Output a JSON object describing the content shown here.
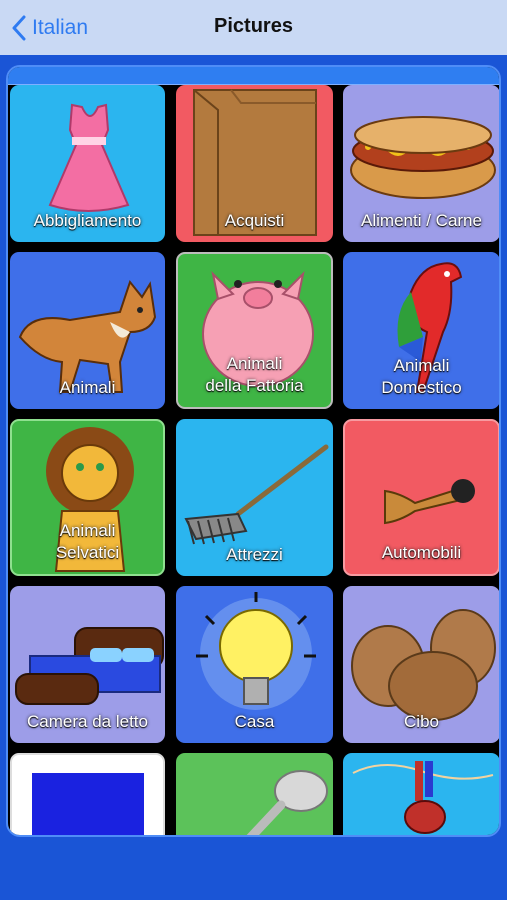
{
  "nav": {
    "back_label": "Italian",
    "title": "Pictures"
  },
  "tiles": [
    {
      "label": "Abbigliamento",
      "icon": "dress-icon",
      "color": "#2bb5ef"
    },
    {
      "label": "Acquisti",
      "icon": "paper-bag-icon",
      "color": "#f25a62"
    },
    {
      "label": "Alimenti / Carne",
      "icon": "hot-dog-icon",
      "color": "#9d9de8"
    },
    {
      "label": "Animali",
      "icon": "fox-icon",
      "color": "#3f6fe9"
    },
    {
      "label": "Animali\ndella Fattoria",
      "icon": "pig-icon",
      "color": "#3fb545"
    },
    {
      "label": "Animali\nDomestico",
      "icon": "parrot-icon",
      "color": "#3f6fe9"
    },
    {
      "label": "Animali\nSelvatici",
      "icon": "lion-icon",
      "color": "#3fb545"
    },
    {
      "label": "Attrezzi",
      "icon": "rake-icon",
      "color": "#2bb5ef"
    },
    {
      "label": "Automobili",
      "icon": "car-horn-icon",
      "color": "#f25a62"
    },
    {
      "label": "Camera da letto",
      "icon": "bed-icon",
      "color": "#9d9de8"
    },
    {
      "label": "Casa",
      "icon": "light-bulb-icon",
      "color": "#3f6fe9"
    },
    {
      "label": "Cibo",
      "icon": "eggs-icon",
      "color": "#9d9de8"
    },
    {
      "label": "",
      "icon": "blue-square-icon",
      "color": "#ffffff"
    },
    {
      "label": "",
      "icon": "spoon-icon",
      "color": "#5cc25a"
    },
    {
      "label": "",
      "icon": "anatomy-icon",
      "color": "#2bb5ef"
    }
  ]
}
